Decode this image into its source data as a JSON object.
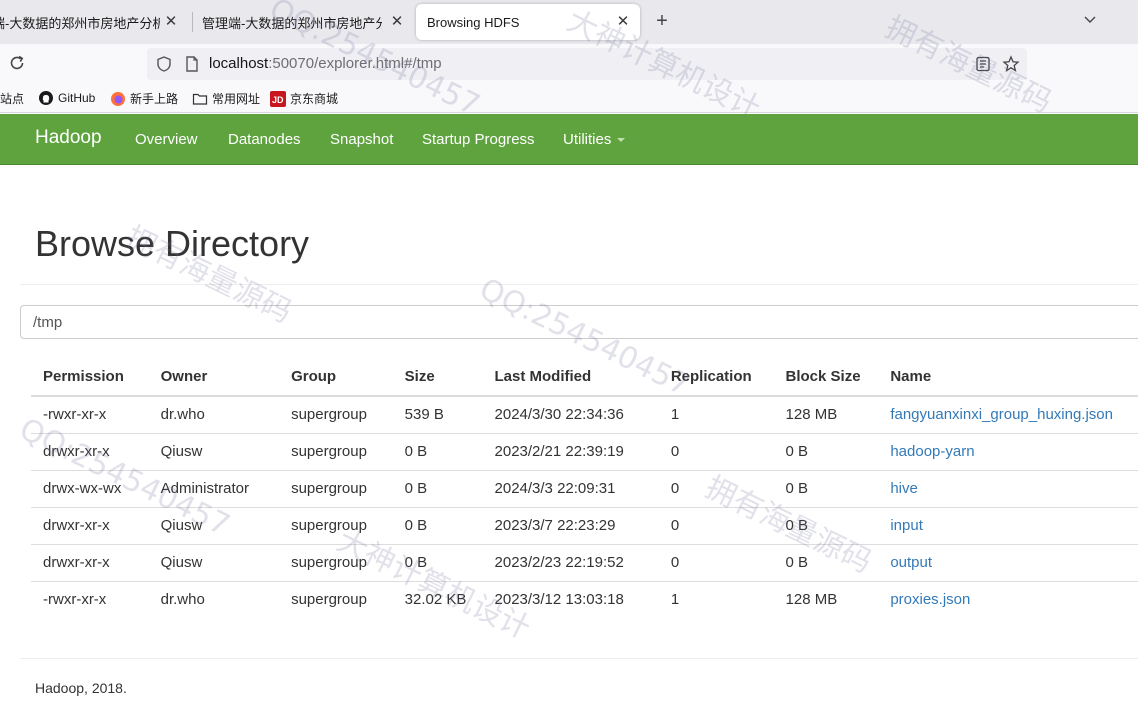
{
  "browser": {
    "tabs": [
      {
        "title": "端-大数据的郑州市房地产分析",
        "active": false
      },
      {
        "title": "管理端-大数据的郑州市房地产分析-",
        "active": false
      },
      {
        "title": "Browsing HDFS",
        "active": true
      }
    ],
    "new_tab": "+",
    "url_host": "localhost",
    "url_rest": ":50070/explorer.html#/tmp",
    "bookmarks": [
      "站点",
      "GitHub",
      "新手上路",
      "常用网址",
      "京东商城"
    ]
  },
  "navbar": {
    "brand": "Hadoop",
    "links": [
      "Overview",
      "Datanodes",
      "Snapshot",
      "Startup Progress",
      "Utilities"
    ]
  },
  "page": {
    "title": "Browse Directory",
    "path": "/tmp",
    "footer": "Hadoop, 2018."
  },
  "table": {
    "headers": [
      "Permission",
      "Owner",
      "Group",
      "Size",
      "Last Modified",
      "Replication",
      "Block Size",
      "Name"
    ],
    "rows": [
      [
        "-rwxr-xr-x",
        "dr.who",
        "supergroup",
        "539 B",
        "2024/3/30 22:34:36",
        "1",
        "128 MB",
        "fangyuanxinxi_group_huxing.json"
      ],
      [
        "drwxr-xr-x",
        "Qiusw",
        "supergroup",
        "0 B",
        "2023/2/21 22:39:19",
        "0",
        "0 B",
        "hadoop-yarn"
      ],
      [
        "drwx-wx-wx",
        "Administrator",
        "supergroup",
        "0 B",
        "2024/3/3 22:09:31",
        "0",
        "0 B",
        "hive"
      ],
      [
        "drwxr-xr-x",
        "Qiusw",
        "supergroup",
        "0 B",
        "2023/3/7 22:23:29",
        "0",
        "0 B",
        "input"
      ],
      [
        "drwxr-xr-x",
        "Qiusw",
        "supergroup",
        "0 B",
        "2023/2/23 22:19:52",
        "0",
        "0 B",
        "output"
      ],
      [
        "-rwxr-xr-x",
        "dr.who",
        "supergroup",
        "32.02 KB",
        "2023/3/12 13:03:18",
        "1",
        "128 MB",
        "proxies.json"
      ]
    ]
  },
  "watermarks": {
    "qq": "QQ:254540457",
    "team": "大神计算机设计",
    "source": "拥有海量源码"
  },
  "colors": {
    "navbar": "#5fa33e",
    "link": "#337ab7"
  }
}
